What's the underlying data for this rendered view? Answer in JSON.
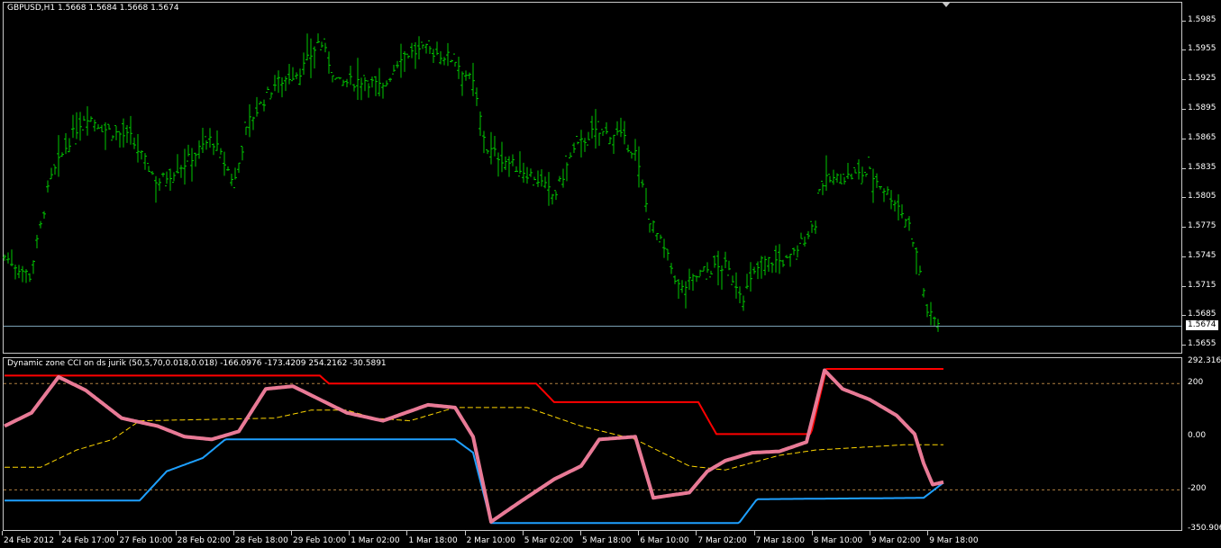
{
  "main": {
    "title": "GBPUSD,H1  1.5668 1.5684 1.5668 1.5674",
    "current_price": "1.5674",
    "price_labels": [
      "1.5985",
      "1.5955",
      "1.5925",
      "1.5895",
      "1.5865",
      "1.5835",
      "1.5805",
      "1.5775",
      "1.5745",
      "1.5715",
      "1.5685",
      "1.5655"
    ],
    "bar_color": "#00c800"
  },
  "indicator": {
    "title": "Dynamic zone CCI on ds jurik (50,5,70,0.018,0.018) -166.0976 -173.4209 254.2162 -30.5891",
    "scale_labels": [
      "292.3167",
      "200",
      "0.00",
      "-200",
      "-350.9064"
    ],
    "colors": {
      "cci": "#e87a96",
      "upper": "#ff0000",
      "lower": "#1ea0ff",
      "mid": "#ffd700",
      "level": "#b08040"
    }
  },
  "time_axis": [
    "24 Feb 2012",
    "24 Feb 17:00",
    "27 Feb 10:00",
    "28 Feb 02:00",
    "28 Feb 18:00",
    "29 Feb 10:00",
    "1 Mar 02:00",
    "1 Mar 18:00",
    "2 Mar 10:00",
    "5 Mar 02:00",
    "5 Mar 18:00",
    "6 Mar 10:00",
    "7 Mar 02:00",
    "7 Mar 18:00",
    "8 Mar 10:00",
    "9 Mar 02:00",
    "9 Mar 18:00"
  ],
  "chart_data": {
    "type": "line",
    "price_anchors": [
      [
        0,
        1.5745
      ],
      [
        28,
        1.5725
      ],
      [
        40,
        1.5775
      ],
      [
        50,
        1.582
      ],
      [
        70,
        1.586
      ],
      [
        90,
        1.589
      ],
      [
        110,
        1.5875
      ],
      [
        140,
        1.5865
      ],
      [
        170,
        1.582
      ],
      [
        200,
        1.584
      ],
      [
        230,
        1.5865
      ],
      [
        255,
        1.582
      ],
      [
        270,
        1.588
      ],
      [
        300,
        1.592
      ],
      [
        330,
        1.5935
      ],
      [
        350,
        1.5965
      ],
      [
        370,
        1.592
      ],
      [
        400,
        1.5925
      ],
      [
        420,
        1.5915
      ],
      [
        440,
        1.595
      ],
      [
        470,
        1.5955
      ],
      [
        500,
        1.5945
      ],
      [
        520,
        1.592
      ],
      [
        535,
        1.5855
      ],
      [
        560,
        1.584
      ],
      [
        590,
        1.5825
      ],
      [
        610,
        1.5805
      ],
      [
        630,
        1.585
      ],
      [
        650,
        1.587
      ],
      [
        680,
        1.587
      ],
      [
        700,
        1.585
      ],
      [
        715,
        1.5785
      ],
      [
        735,
        1.5745
      ],
      [
        750,
        1.571
      ],
      [
        775,
        1.573
      ],
      [
        800,
        1.5735
      ],
      [
        820,
        1.5705
      ],
      [
        840,
        1.574
      ],
      [
        870,
        1.574
      ],
      [
        900,
        1.578
      ],
      [
        905,
        1.582
      ],
      [
        930,
        1.5825
      ],
      [
        960,
        1.583
      ],
      [
        990,
        1.58
      ],
      [
        1005,
        1.5775
      ],
      [
        1015,
        1.5735
      ],
      [
        1025,
        1.5685
      ],
      [
        1043,
        1.5674
      ]
    ],
    "cci": [
      [
        0,
        40
      ],
      [
        30,
        90
      ],
      [
        60,
        225
      ],
      [
        90,
        175
      ],
      [
        130,
        70
      ],
      [
        170,
        40
      ],
      [
        200,
        0
      ],
      [
        230,
        -10
      ],
      [
        260,
        20
      ],
      [
        290,
        180
      ],
      [
        320,
        190
      ],
      [
        350,
        140
      ],
      [
        380,
        90
      ],
      [
        420,
        60
      ],
      [
        470,
        120
      ],
      [
        500,
        110
      ],
      [
        520,
        0
      ],
      [
        540,
        -320
      ],
      [
        570,
        -250
      ],
      [
        610,
        -160
      ],
      [
        640,
        -110
      ],
      [
        660,
        -10
      ],
      [
        700,
        0
      ],
      [
        720,
        -230
      ],
      [
        740,
        -220
      ],
      [
        760,
        -210
      ],
      [
        780,
        -130
      ],
      [
        800,
        -90
      ],
      [
        830,
        -60
      ],
      [
        860,
        -55
      ],
      [
        890,
        -20
      ],
      [
        910,
        250
      ],
      [
        930,
        180
      ],
      [
        960,
        140
      ],
      [
        990,
        80
      ],
      [
        1010,
        10
      ],
      [
        1020,
        -100
      ],
      [
        1030,
        -180
      ],
      [
        1043,
        -170
      ]
    ],
    "upper": [
      [
        0,
        230
      ],
      [
        350,
        230
      ],
      [
        360,
        200
      ],
      [
        590,
        200
      ],
      [
        610,
        130
      ],
      [
        770,
        130
      ],
      [
        790,
        10
      ],
      [
        895,
        10
      ],
      [
        912,
        255
      ],
      [
        1043,
        255
      ]
    ],
    "lower": [
      [
        0,
        -240
      ],
      [
        150,
        -240
      ],
      [
        180,
        -130
      ],
      [
        220,
        -80
      ],
      [
        245,
        -10
      ],
      [
        500,
        -10
      ],
      [
        520,
        -60
      ],
      [
        540,
        -325
      ],
      [
        815,
        -325
      ],
      [
        835,
        -235
      ],
      [
        1020,
        -230
      ],
      [
        1043,
        -170
      ]
    ],
    "mid": [
      [
        0,
        -115
      ],
      [
        40,
        -115
      ],
      [
        80,
        -50
      ],
      [
        120,
        -10
      ],
      [
        150,
        60
      ],
      [
        300,
        70
      ],
      [
        340,
        100
      ],
      [
        380,
        100
      ],
      [
        410,
        70
      ],
      [
        450,
        60
      ],
      [
        500,
        110
      ],
      [
        580,
        110
      ],
      [
        640,
        40
      ],
      [
        700,
        -10
      ],
      [
        760,
        -110
      ],
      [
        800,
        -125
      ],
      [
        860,
        -70
      ],
      [
        900,
        -50
      ],
      [
        1000,
        -30
      ],
      [
        1043,
        -30
      ]
    ],
    "levels": [
      200,
      -200
    ],
    "ylim": [
      -350.9064,
      292.3167
    ],
    "price_ylim": [
      1.5647,
      1.6002
    ]
  }
}
